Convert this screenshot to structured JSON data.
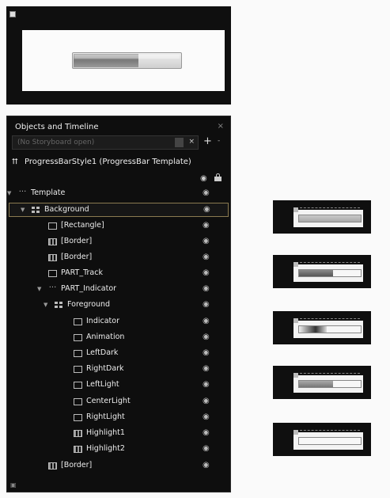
{
  "panel": {
    "title": "Objects and Timeline",
    "close_label": "×",
    "storyboard": {
      "placeholder": "(No Storyboard open)",
      "close_label": "×",
      "add_label": "+",
      "more_label": "-"
    },
    "scope_label": "ProgressBarStyle1 (ProgressBar Template)",
    "tree": [
      {
        "label": "Template",
        "icon": "template-dots-icon",
        "expander": "▼",
        "level": 0
      },
      {
        "label": "Background",
        "icon": "grid-icon",
        "expander": "▼",
        "level": 1,
        "selected": true
      },
      {
        "label": "[Rectangle]",
        "icon": "rectangle-icon",
        "level": 2
      },
      {
        "label": "[Border]",
        "icon": "border-icon",
        "level": 2
      },
      {
        "label": "[Border]",
        "icon": "border-icon",
        "level": 2
      },
      {
        "label": "PART_Track",
        "icon": "rectangle-icon",
        "level": 2
      },
      {
        "label": "PART_Indicator",
        "icon": "template-dots-icon",
        "expander": "▼",
        "level": 2
      },
      {
        "label": "Foreground",
        "icon": "grid-icon",
        "expander": "▼",
        "level": 3
      },
      {
        "label": "Indicator",
        "icon": "rectangle-icon",
        "level": 4
      },
      {
        "label": "Animation",
        "icon": "rectangle-icon",
        "level": 4
      },
      {
        "label": "LeftDark",
        "icon": "rectangle-icon",
        "level": 4
      },
      {
        "label": "RightDark",
        "icon": "rectangle-icon",
        "level": 4
      },
      {
        "label": "LeftLight",
        "icon": "rectangle-icon",
        "level": 4
      },
      {
        "label": "CenterLight",
        "icon": "rectangle-icon",
        "level": 4
      },
      {
        "label": "RightLight",
        "icon": "rectangle-icon",
        "level": 4
      },
      {
        "label": "Highlight1",
        "icon": "border-icon",
        "level": 4
      },
      {
        "label": "Highlight2",
        "icon": "border-icon",
        "level": 4
      },
      {
        "label": "[Border]",
        "icon": "border-icon",
        "level": 2
      }
    ]
  },
  "thumbnails": [
    {
      "fill_fraction": 1.0,
      "fill_style": "light-gray"
    },
    {
      "fill_fraction": 0.55,
      "fill_style": "dark-gray"
    },
    {
      "fill_fraction": 0.45,
      "fill_style": "dark-gradient"
    },
    {
      "fill_fraction": 0.55,
      "fill_style": "medium-gray"
    },
    {
      "fill_fraction": 0.0,
      "fill_style": "empty"
    }
  ],
  "artboard": {
    "progress_fraction": 0.6
  },
  "colors": {
    "panel_bg": "#0e0e0e",
    "selection_border": "#8a7a50",
    "text": "#ececec"
  }
}
